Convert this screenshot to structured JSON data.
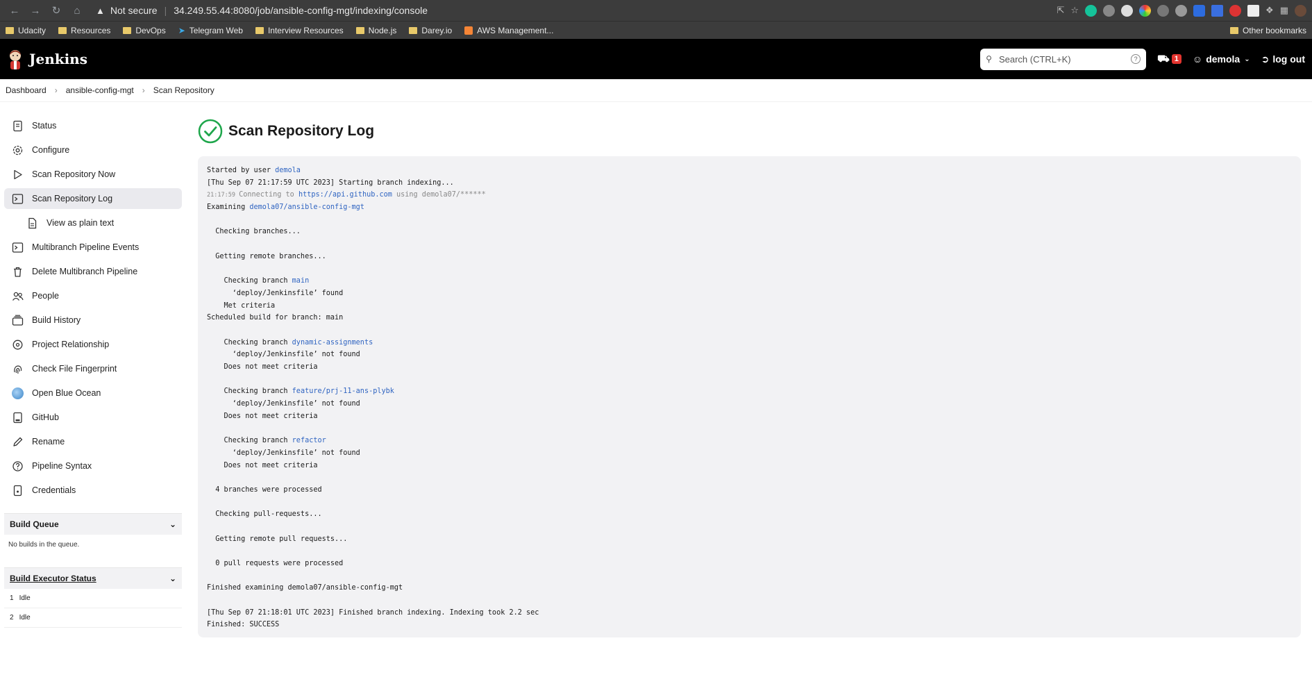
{
  "browser": {
    "security": "Not secure",
    "url": "34.249.55.44:8080/job/ansible-config-mgt/indexing/console",
    "bookmarks": [
      "Udacity",
      "Resources",
      "DevOps",
      "Telegram Web",
      "Interview Resources",
      "Node.js",
      "Darey.io",
      "AWS Management..."
    ],
    "other_bookmarks": "Other bookmarks"
  },
  "header": {
    "brand": "Jenkins",
    "search_placeholder": "Search (CTRL+K)",
    "security_count": "1",
    "user": "demola",
    "logout": "log out"
  },
  "breadcrumb": [
    "Dashboard",
    "ansible-config-mgt",
    "Scan Repository"
  ],
  "sidebar": {
    "items": [
      {
        "label": "Status",
        "icon": "document-icon"
      },
      {
        "label": "Configure",
        "icon": "gear-icon"
      },
      {
        "label": "Scan Repository Now",
        "icon": "play-icon"
      },
      {
        "label": "Scan Repository Log",
        "icon": "terminal-icon",
        "active": true
      },
      {
        "label": "View as plain text",
        "icon": "file-icon",
        "sub": true
      },
      {
        "label": "Multibranch Pipeline Events",
        "icon": "terminal-icon"
      },
      {
        "label": "Delete Multibranch Pipeline",
        "icon": "trash-icon"
      },
      {
        "label": "People",
        "icon": "people-icon"
      },
      {
        "label": "Build History",
        "icon": "history-icon"
      },
      {
        "label": "Project Relationship",
        "icon": "relationship-icon"
      },
      {
        "label": "Check File Fingerprint",
        "icon": "fingerprint-icon"
      },
      {
        "label": "Open Blue Ocean",
        "icon": "blue-ocean-icon"
      },
      {
        "label": "GitHub",
        "icon": "github-icon"
      },
      {
        "label": "Rename",
        "icon": "pencil-icon"
      },
      {
        "label": "Pipeline Syntax",
        "icon": "question-icon"
      },
      {
        "label": "Credentials",
        "icon": "credentials-icon"
      }
    ],
    "build_queue": {
      "title": "Build Queue",
      "body": "No builds in the queue."
    },
    "executors": {
      "title": "Build Executor Status",
      "rows": [
        {
          "num": "1",
          "status": "Idle"
        },
        {
          "num": "2",
          "status": "Idle"
        }
      ]
    }
  },
  "main": {
    "title": "Scan Repository Log",
    "log": [
      {
        "parts": [
          {
            "t": "Started by user "
          },
          {
            "t": "demola",
            "c": "lk"
          }
        ]
      },
      {
        "parts": [
          {
            "t": "[Thu Sep 07 21:17:59 UTC 2023] Starting branch indexing..."
          }
        ]
      },
      {
        "parts": [
          {
            "t": "21:17:59 ",
            "c": "ts"
          },
          {
            "t": "Connecting to ",
            "c": "mut"
          },
          {
            "t": "https://api.github.com",
            "c": "lk"
          },
          {
            "t": " using demola07/******",
            "c": "mut"
          }
        ]
      },
      {
        "parts": [
          {
            "t": "Examining "
          },
          {
            "t": "demola07/ansible-config-mgt",
            "c": "lk"
          }
        ]
      },
      {
        "parts": [
          {
            "t": ""
          }
        ]
      },
      {
        "parts": [
          {
            "t": "  Checking branches..."
          }
        ]
      },
      {
        "parts": [
          {
            "t": ""
          }
        ]
      },
      {
        "parts": [
          {
            "t": "  Getting remote branches..."
          }
        ]
      },
      {
        "parts": [
          {
            "t": ""
          }
        ]
      },
      {
        "parts": [
          {
            "t": "    Checking branch "
          },
          {
            "t": "main",
            "c": "lk"
          }
        ]
      },
      {
        "parts": [
          {
            "t": "      ‘deploy/Jenkinsfile’ found"
          }
        ]
      },
      {
        "parts": [
          {
            "t": "    Met criteria"
          }
        ]
      },
      {
        "parts": [
          {
            "t": "Scheduled build for branch: main"
          }
        ]
      },
      {
        "parts": [
          {
            "t": ""
          }
        ]
      },
      {
        "parts": [
          {
            "t": "    Checking branch "
          },
          {
            "t": "dynamic-assignments",
            "c": "lk"
          }
        ]
      },
      {
        "parts": [
          {
            "t": "      ‘deploy/Jenkinsfile’ not found"
          }
        ]
      },
      {
        "parts": [
          {
            "t": "    Does not meet criteria"
          }
        ]
      },
      {
        "parts": [
          {
            "t": ""
          }
        ]
      },
      {
        "parts": [
          {
            "t": "    Checking branch "
          },
          {
            "t": "feature/prj-11-ans-plybk",
            "c": "lk"
          }
        ]
      },
      {
        "parts": [
          {
            "t": "      ‘deploy/Jenkinsfile’ not found"
          }
        ]
      },
      {
        "parts": [
          {
            "t": "    Does not meet criteria"
          }
        ]
      },
      {
        "parts": [
          {
            "t": ""
          }
        ]
      },
      {
        "parts": [
          {
            "t": "    Checking branch "
          },
          {
            "t": "refactor",
            "c": "lk"
          }
        ]
      },
      {
        "parts": [
          {
            "t": "      ‘deploy/Jenkinsfile’ not found"
          }
        ]
      },
      {
        "parts": [
          {
            "t": "    Does not meet criteria"
          }
        ]
      },
      {
        "parts": [
          {
            "t": ""
          }
        ]
      },
      {
        "parts": [
          {
            "t": "  4 branches were processed"
          }
        ]
      },
      {
        "parts": [
          {
            "t": ""
          }
        ]
      },
      {
        "parts": [
          {
            "t": "  Checking pull-requests..."
          }
        ]
      },
      {
        "parts": [
          {
            "t": ""
          }
        ]
      },
      {
        "parts": [
          {
            "t": "  Getting remote pull requests..."
          }
        ]
      },
      {
        "parts": [
          {
            "t": ""
          }
        ]
      },
      {
        "parts": [
          {
            "t": "  0 pull requests were processed"
          }
        ]
      },
      {
        "parts": [
          {
            "t": ""
          }
        ]
      },
      {
        "parts": [
          {
            "t": "Finished examining demola07/ansible-config-mgt"
          }
        ]
      },
      {
        "parts": [
          {
            "t": ""
          }
        ]
      },
      {
        "parts": [
          {
            "t": "[Thu Sep 07 21:18:01 UTC 2023] Finished branch indexing. Indexing took 2.2 sec"
          }
        ]
      },
      {
        "parts": [
          {
            "t": "Finished: SUCCESS"
          }
        ]
      }
    ]
  },
  "colors": {
    "link": "#2f64c1",
    "success": "#1ea64b",
    "alert": "#e3342f"
  }
}
